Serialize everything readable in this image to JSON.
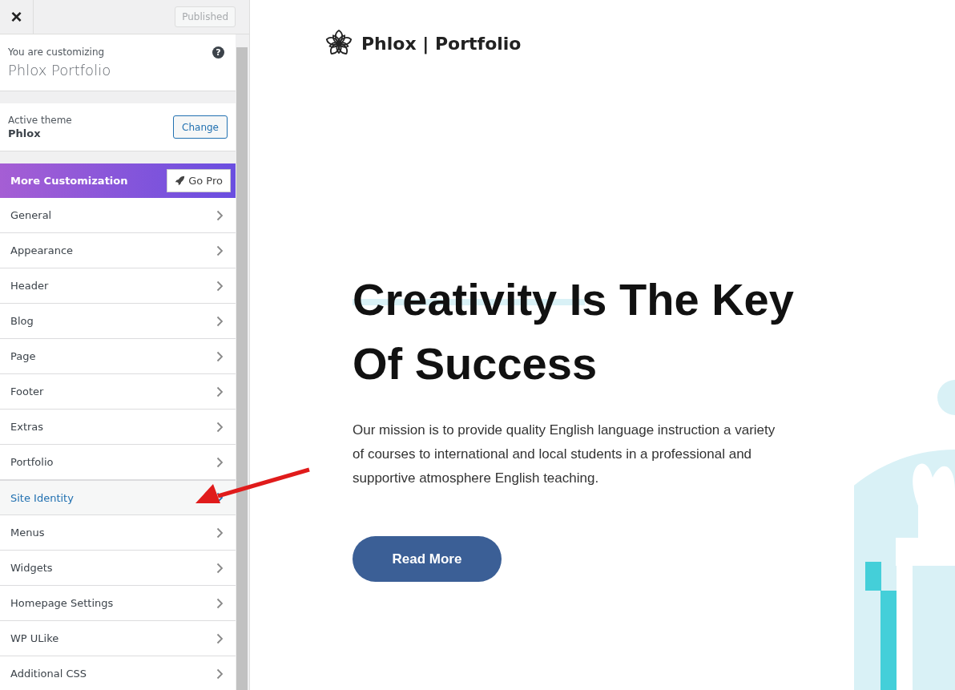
{
  "header": {
    "close": "×",
    "publish_button": "Published"
  },
  "customizing": {
    "label": "You are customizing",
    "site_name": "Phlox Portfolio",
    "help": "?"
  },
  "theme": {
    "label": "Active theme",
    "name": "Phlox",
    "change_button": "Change"
  },
  "promo": {
    "title": "More Customization",
    "button": "Go Pro"
  },
  "menu": [
    {
      "label": "General",
      "selected": false
    },
    {
      "label": "Appearance",
      "selected": false
    },
    {
      "label": "Header",
      "selected": false
    },
    {
      "label": "Blog",
      "selected": false
    },
    {
      "label": "Page",
      "selected": false
    },
    {
      "label": "Footer",
      "selected": false
    },
    {
      "label": "Extras",
      "selected": false
    },
    {
      "label": "Portfolio",
      "selected": false
    },
    {
      "label": "Site Identity",
      "selected": true
    },
    {
      "label": "Menus",
      "selected": false
    },
    {
      "label": "Widgets",
      "selected": false
    },
    {
      "label": "Homepage Settings",
      "selected": false
    },
    {
      "label": "WP ULike",
      "selected": false
    },
    {
      "label": "Additional CSS",
      "selected": false
    }
  ],
  "preview": {
    "logo": "Phlox | Portfolio",
    "heading_line_1": "Creativity Is The Key",
    "heading_line_2": "Of Success",
    "text": "Our mission is to provide quality English language instruction a variety of courses to international and local students in a professional and supportive atmosphere English teaching.",
    "button": "Read More"
  }
}
